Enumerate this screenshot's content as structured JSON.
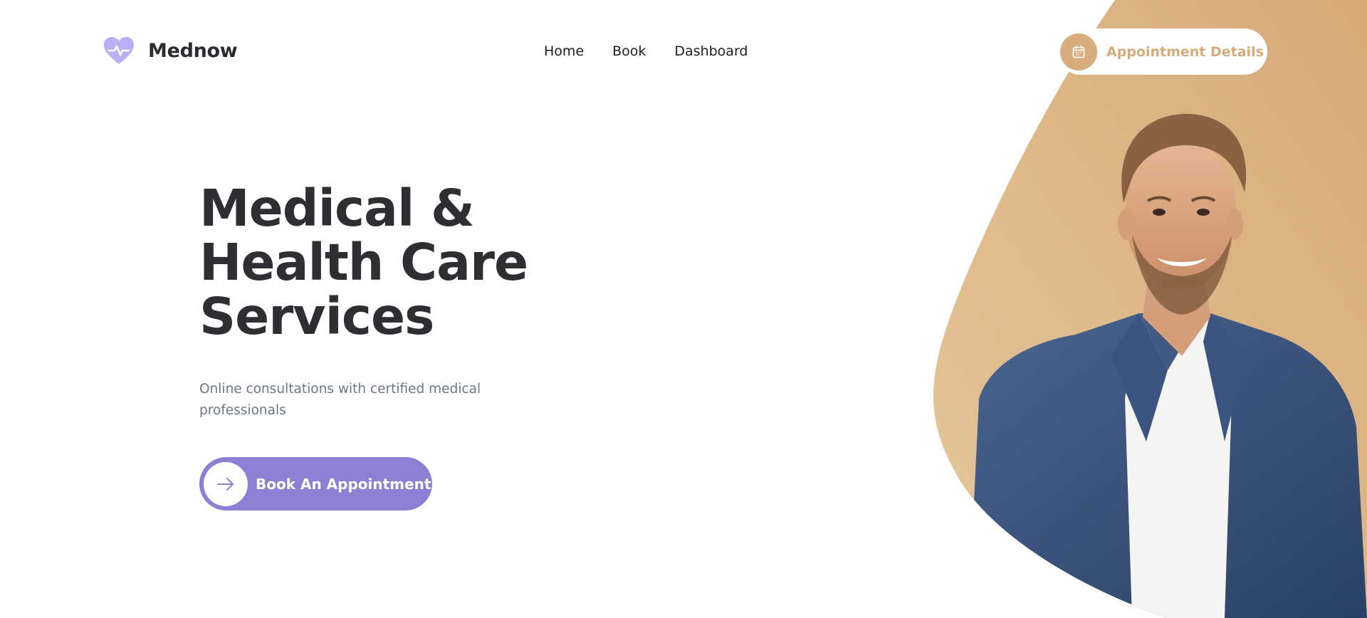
{
  "brand": {
    "name": "Mednow",
    "logo_icon": "heart-pulse-icon",
    "color": "#b9b0f3"
  },
  "nav": {
    "items": [
      "Home",
      "Book",
      "Dashboard"
    ]
  },
  "header_button": {
    "label": "Appointment Details",
    "icon": "calendar-icon",
    "color": "#d8ad7d"
  },
  "hero": {
    "title_lines": [
      "Medical &",
      "Health Care",
      "Services"
    ],
    "subtitle": "Online consultations with certified medical professionals",
    "cta": {
      "label": "Book An Appointment",
      "icon": "arrow-right-icon",
      "color": "#8b80d3"
    },
    "image": "smiling-doctor-photo",
    "accent_color": "#d8ad7d"
  }
}
